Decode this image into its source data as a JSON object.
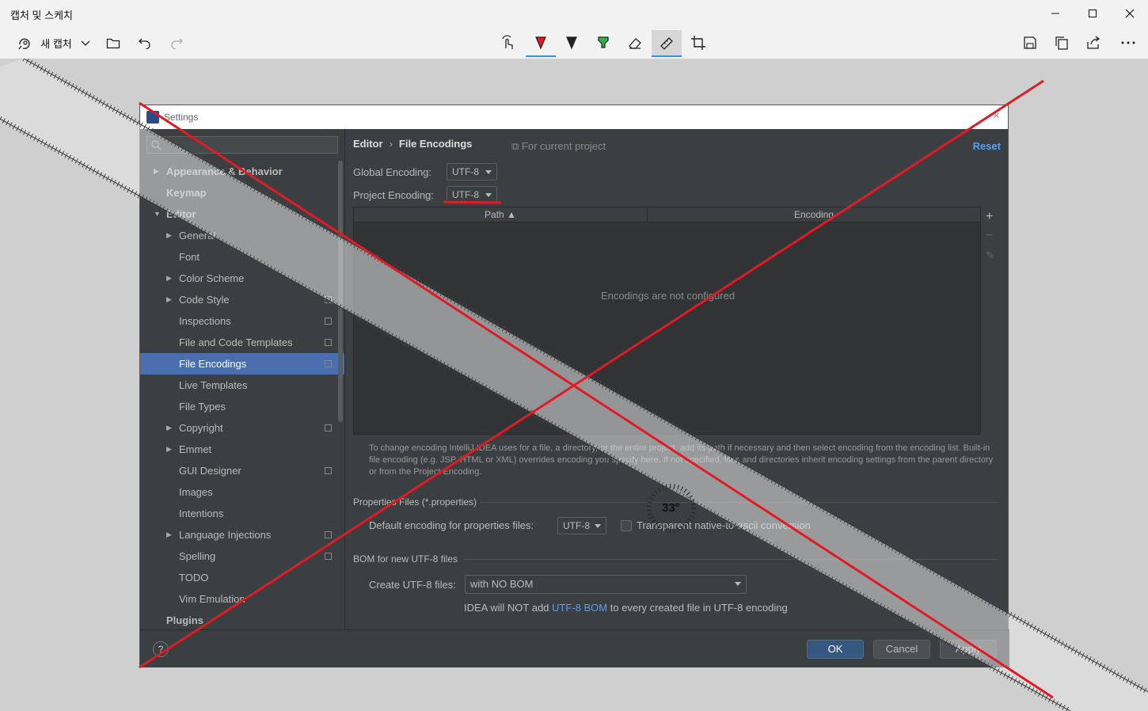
{
  "app": {
    "title": "캡처 및 스케치",
    "new_capture_label": "새 캡처"
  },
  "toolbar": {
    "left_icons": [
      "new-capture-icon",
      "chevron-down-icon",
      "open-folder-icon",
      "undo-icon",
      "redo-icon"
    ],
    "center_tools": [
      "touch-writing-icon",
      "ballpoint-pen-icon",
      "pencil-icon",
      "highlighter-icon",
      "eraser-icon",
      "ruler-icon",
      "crop-icon"
    ],
    "right_icons": [
      "save-icon",
      "copy-icon",
      "share-icon",
      "more-icon"
    ],
    "pen_colors": {
      "ballpoint": "#e01b24",
      "pencil": "#222222",
      "highlighter": "#2fb24a"
    }
  },
  "settings": {
    "window_title": "Settings",
    "sidebar": {
      "items": [
        {
          "label": "Appearance & Behavior",
          "level": 0,
          "bold": true,
          "arrow": "right"
        },
        {
          "label": "Keymap",
          "level": 0,
          "bold": true
        },
        {
          "label": "Editor",
          "level": 0,
          "bold": true,
          "arrow": "down"
        },
        {
          "label": "General",
          "level": 1,
          "arrow": "right"
        },
        {
          "label": "Font",
          "level": 1
        },
        {
          "label": "Color Scheme",
          "level": 1,
          "arrow": "right"
        },
        {
          "label": "Code Style",
          "level": 1,
          "arrow": "right",
          "copy": true
        },
        {
          "label": "Inspections",
          "level": 1,
          "copy": true
        },
        {
          "label": "File and Code Templates",
          "level": 1,
          "copy": true
        },
        {
          "label": "File Encodings",
          "level": 1,
          "copy": true,
          "selected": true
        },
        {
          "label": "Live Templates",
          "level": 1
        },
        {
          "label": "File Types",
          "level": 1
        },
        {
          "label": "Copyright",
          "level": 1,
          "arrow": "right",
          "copy": true
        },
        {
          "label": "Emmet",
          "level": 1,
          "arrow": "right"
        },
        {
          "label": "GUI Designer",
          "level": 1,
          "copy": true
        },
        {
          "label": "Images",
          "level": 1
        },
        {
          "label": "Intentions",
          "level": 1
        },
        {
          "label": "Language Injections",
          "level": 1,
          "arrow": "right",
          "copy": true
        },
        {
          "label": "Spelling",
          "level": 1,
          "copy": true
        },
        {
          "label": "TODO",
          "level": 1
        },
        {
          "label": "Vim Emulation",
          "level": 1
        },
        {
          "label": "Plugins",
          "level": 0,
          "bold": true
        }
      ]
    },
    "breadcrumb": {
      "parent": "Editor",
      "separator": "›",
      "current": "File Encodings"
    },
    "for_current_project": "For current project",
    "reset": "Reset",
    "global_encoding": {
      "label": "Global Encoding:",
      "value": "UTF-8"
    },
    "project_encoding": {
      "label": "Project Encoding:",
      "value": "UTF-8"
    },
    "table": {
      "columns": [
        "Path",
        "Encoding"
      ],
      "empty_text": "Encodings are not configured"
    },
    "hint": "To change encoding IntelliJ IDEA uses for a file, a directory, or the entire project, add its path if necessary and then select encoding from the encoding list. Built-in file encoding (e.g. JSP, HTML or XML) overrides encoding you specify here. If not specified, files and directories inherit encoding settings from the parent directory or from the Project Encoding.",
    "properties": {
      "section": "Properties Files (*.properties)",
      "default_label": "Default encoding for properties files:",
      "default_value": "UTF-8",
      "transparent_label": "Transparent native-to-ascii conversion"
    },
    "bom": {
      "section": "BOM for new UTF-8 files",
      "create_label": "Create UTF-8 files:",
      "create_value": "with NO BOM",
      "note_prefix": "IDEA will NOT add",
      "note_link": "UTF-8 BOM",
      "note_suffix": "to every created file in UTF-8 encoding"
    },
    "buttons": {
      "ok": "OK",
      "cancel": "Cancel",
      "apply": "Apply",
      "help": "?"
    }
  },
  "protractor": {
    "angle_readout": "33°"
  },
  "colors": {
    "annotation_red": "#e01b24",
    "selection_blue": "#4b6eaf",
    "link_blue": "#589df6"
  }
}
